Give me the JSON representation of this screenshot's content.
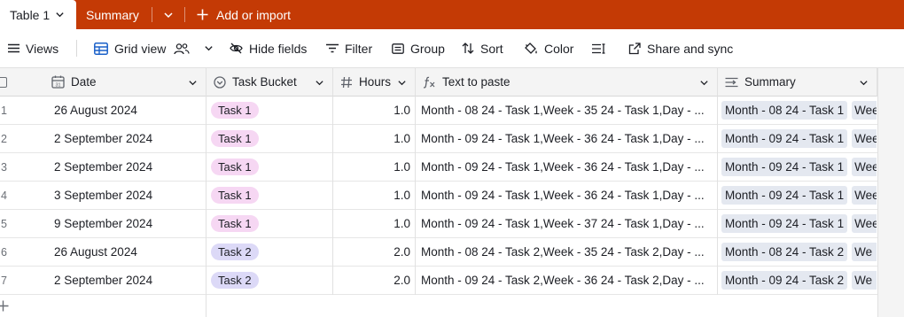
{
  "tabs": {
    "active": "Table 1",
    "summary": "Summary",
    "add_import": "Add or import"
  },
  "toolbar": {
    "views": "Views",
    "grid_view": "Grid view",
    "hide_fields": "Hide fields",
    "filter": "Filter",
    "group": "Group",
    "sort": "Sort",
    "color": "Color",
    "share_sync": "Share and sync"
  },
  "columns": {
    "date": "Date",
    "task_bucket": "Task Bucket",
    "hours": "Hours",
    "text_to_paste": "Text to paste",
    "summary": "Summary"
  },
  "rows": [
    {
      "num": "1",
      "date": "26 August 2024",
      "bucket": "Task 1",
      "hours": "1.0",
      "text": "Month - 08 24 - Task 1,Week - 35 24 - Task 1,Day - ...",
      "summary": "Month - 08 24 - Task 1",
      "summary_next": "Wee"
    },
    {
      "num": "2",
      "date": "2 September 2024",
      "bucket": "Task 1",
      "hours": "1.0",
      "text": "Month - 09 24 - Task 1,Week - 36 24 - Task 1,Day - ...",
      "summary": "Month - 09 24 - Task 1",
      "summary_next": "Wee"
    },
    {
      "num": "3",
      "date": "2 September 2024",
      "bucket": "Task 1",
      "hours": "1.0",
      "text": "Month - 09 24 - Task 1,Week - 36 24 - Task 1,Day - ...",
      "summary": "Month - 09 24 - Task 1",
      "summary_next": "Wee"
    },
    {
      "num": "4",
      "date": "3 September 2024",
      "bucket": "Task 1",
      "hours": "1.0",
      "text": "Month - 09 24 - Task 1,Week - 36 24 - Task 1,Day - ...",
      "summary": "Month - 09 24 - Task 1",
      "summary_next": "Wee"
    },
    {
      "num": "5",
      "date": "9 September 2024",
      "bucket": "Task 1",
      "hours": "1.0",
      "text": "Month - 09 24 - Task 1,Week - 37 24 - Task 1,Day - ...",
      "summary": "Month - 09 24 - Task 1",
      "summary_next": "Wee"
    },
    {
      "num": "6",
      "date": "26 August 2024",
      "bucket": "Task 2",
      "hours": "2.0",
      "text": "Month - 08 24 - Task 2,Week - 35 24 - Task 2,Day - ...",
      "summary": "Month - 08 24 - Task 2",
      "summary_next": "We"
    },
    {
      "num": "7",
      "date": "2 September 2024",
      "bucket": "Task 2",
      "hours": "2.0",
      "text": "Month - 09 24 - Task 2,Week - 36 24 - Task 2,Day - ...",
      "summary": "Month - 09 24 - Task 2",
      "summary_next": "We"
    }
  ],
  "colors": {
    "brand_bar": "#c43a05",
    "task1_pill": "#f6d7f3",
    "task2_pill": "#dcd9f7",
    "summary_chip": "#e4e8f0"
  },
  "icons": {
    "views": "hamburger-icon",
    "grid_view": "grid-icon",
    "collaborators": "people-icon",
    "hide_fields": "eye-slash-icon",
    "filter": "filter-icon",
    "group": "group-icon",
    "sort": "sort-icon",
    "color": "paint-bucket-icon",
    "row_height": "row-height-icon",
    "share": "share-icon",
    "add_row": "plus-icon"
  }
}
